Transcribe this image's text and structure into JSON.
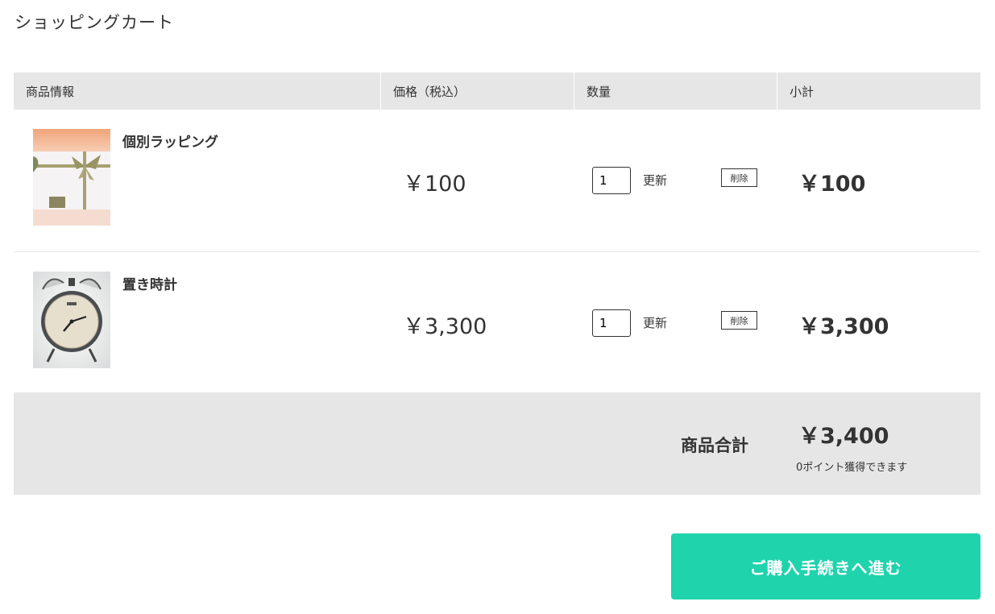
{
  "page": {
    "title": "ショッピングカート"
  },
  "table": {
    "headers": {
      "info": "商品情報",
      "price": "価格（税込）",
      "quantity": "数量",
      "subtotal": "小計"
    }
  },
  "items": [
    {
      "name": "個別ラッピング",
      "price": "￥100",
      "quantity": "1",
      "update_label": "更新",
      "delete_label": "削除",
      "subtotal": "￥100",
      "image": "gift-wrapping-photo"
    },
    {
      "name": "置き時計",
      "price": "￥3,300",
      "quantity": "1",
      "update_label": "更新",
      "delete_label": "削除",
      "subtotal": "￥3,300",
      "image": "alarm-clock-photo"
    }
  ],
  "total": {
    "label": "商品合計",
    "value": "￥3,400",
    "points_note": "0ポイント獲得できます"
  },
  "checkout": {
    "label": "ご購入手続きへ進む"
  },
  "colors": {
    "accent": "#1fd3ad",
    "table_bg": "#e6e6e6",
    "text": "#333333"
  }
}
